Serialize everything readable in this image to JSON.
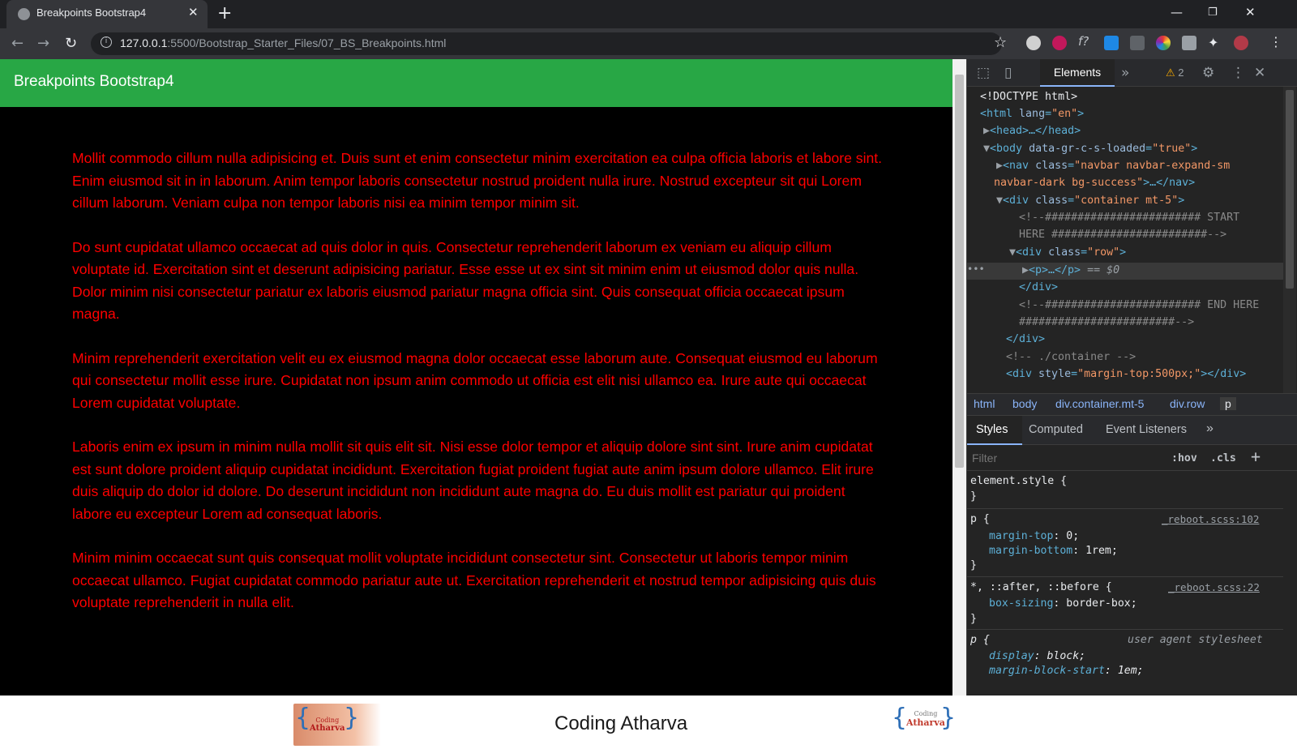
{
  "browser": {
    "tab_title": "Breakpoints Bootstrap4",
    "url_host": "127.0.0.1",
    "url_rest": ":5500/Bootstrap_Starter_Files/07_BS_Breakpoints.html"
  },
  "page": {
    "brand": "Breakpoints Bootstrap4",
    "paragraphs": [
      "Mollit commodo cillum nulla adipisicing et. Duis sunt et enim consectetur minim exercitation ea culpa officia laboris et labore sint. Enim eiusmod sit in in laborum. Anim tempor laboris consectetur nostrud proident nulla irure. Nostrud excepteur sit qui Lorem cillum laborum. Veniam culpa non tempor laboris nisi ea minim tempor minim sit.",
      "Do sunt cupidatat ullamco occaecat ad quis dolor in quis. Consectetur reprehenderit laborum ex veniam eu aliquip cillum voluptate id. Exercitation sint et deserunt adipisicing pariatur. Esse esse ut ex sint sit minim enim ut eiusmod dolor quis nulla. Dolor minim nisi consectetur pariatur ex laboris eiusmod pariatur magna officia sint. Quis consequat officia occaecat ipsum magna.",
      "Minim reprehenderit exercitation velit eu ex eiusmod magna dolor occaecat esse laborum aute. Consequat eiusmod eu laborum qui consectetur mollit esse irure. Cupidatat non ipsum anim commodo ut officia est elit nisi ullamco ea. Irure aute qui occaecat Lorem cupidatat voluptate.",
      "Laboris enim ex ipsum in minim nulla mollit sit quis elit sit. Nisi esse dolor tempor et aliquip dolore sint sint. Irure anim cupidatat est sunt dolore proident aliquip cupidatat incididunt. Exercitation fugiat proident fugiat aute anim ipsum dolore ullamco. Elit irure duis aliquip do dolor id dolore. Do deserunt incididunt non incididunt aute magna do. Eu duis mollit est pariatur qui proident labore eu excepteur Lorem ad consequat laboris.",
      "Minim minim occaecat sunt quis consequat mollit voluptate incididunt consectetur sint. Consectetur ut laboris tempor minim occaecat ullamco. Fugiat cupidatat commodo pariatur aute ut. Exercitation reprehenderit et nostrud tempor adipisicing quis duis voluptate reprehenderit in nulla elit."
    ]
  },
  "devtools": {
    "tab_elements": "Elements",
    "warnings": "2",
    "tree": {
      "doctype": "<!DOCTYPE html>",
      "html_open": "<html",
      "html_attr": "lang",
      "html_val": "\"en\"",
      "head": "<head>…</head>",
      "body_open": "<body",
      "body_attr": "data-gr-c-s-loaded",
      "body_val": "\"true\"",
      "nav_open": "<nav",
      "nav_attr": "class",
      "nav_val1": "\"navbar navbar-expand-sm",
      "nav_val2": "navbar-dark bg-success\"",
      "nav_close": ">…</nav>",
      "div_container": "<div",
      "div_container_val": "\"container mt-5\"",
      "comment_start1": "<!--######################## START",
      "comment_start2": "HERE ########################-->",
      "div_row_val": "\"row\"",
      "p_collapsed": "<p>…</p>",
      "p_eq": "== $0",
      "div_close": "</div>",
      "comment_end1": "<!--######################## END HERE",
      "comment_end2": "########################-->",
      "comment_container": "<!-- ./container -->",
      "div_style_val": "\"margin-top:500px;\"",
      "div_style_close": "></div>"
    },
    "breadcrumbs": [
      "html",
      "body",
      "div.container.mt-5",
      "div.row",
      "p"
    ],
    "style_tabs": [
      "Styles",
      "Computed",
      "Event Listeners"
    ],
    "filter_placeholder": "Filter",
    "hov": ":hov",
    "cls": ".cls",
    "rules": {
      "element_style": "element.style {",
      "p_selector": "p {",
      "reboot_src1": "_reboot.scss:102",
      "margin_top_prop": "margin-top",
      "margin_top_val": "0;",
      "margin_bottom_prop": "margin-bottom",
      "margin_bottom_val": "1rem;",
      "universal_selector": "*, ::after, ::before {",
      "reboot_src2": "_reboot.scss:22",
      "box_sizing_prop": "box-sizing",
      "box_sizing_val": "border-box;",
      "ua_selector": "p {",
      "ua_label": "user agent stylesheet",
      "display_prop": "display",
      "display_val": "block;",
      "mbs_prop": "margin-block-start",
      "mbs_val": "1em;",
      "close_brace": "}"
    }
  },
  "footer": {
    "title": "Coding Atharva",
    "logo_word_top": "Coding",
    "logo_word_bottom": "Atharva"
  }
}
